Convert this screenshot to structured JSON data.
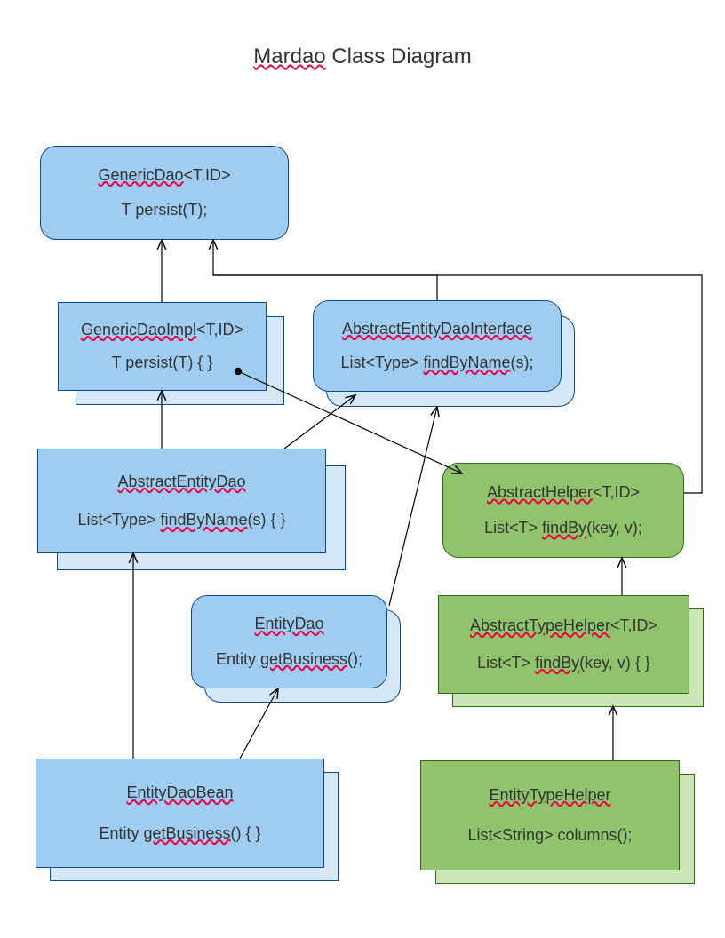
{
  "title": {
    "pre": "Mardao",
    "rest": " Class Diagram"
  },
  "genericDao": {
    "name_pre": "GenericDao",
    "name_suf": "<T,ID>",
    "method": "T persist(T);"
  },
  "genericDaoImpl": {
    "name_pre": "GenericDaoImpl",
    "name_suf": "<T,ID>",
    "method": "T persist(T) { }"
  },
  "abstractEntityDaoInterface": {
    "name": "AbstractEntityDaoInterface",
    "m_pre": "List<Type> ",
    "m_sq": "findByName",
    "m_suf": "(s);"
  },
  "abstractEntityDao": {
    "name": "AbstractEntityDao",
    "m_pre": "List<Type> ",
    "m_sq": "findByName",
    "m_suf": "(s) { }"
  },
  "abstractHelper": {
    "name_pre": "AbstractHelper",
    "name_suf": "<T,ID>",
    "m_pre": "List<T> ",
    "m_sq": "findBy",
    "m_suf": "(key, v);"
  },
  "entityDao": {
    "name": "EntityDao",
    "m_pre": "Entity ",
    "m_sq": "getBusiness",
    "m_suf": "();"
  },
  "abstractTypeHelper": {
    "name_pre": "AbstractTypeHelper",
    "name_suf": "<T,ID>",
    "m_pre": "List<T> ",
    "m_sq": "findBy",
    "m_suf": "(key, v) { }"
  },
  "entityDaoBean": {
    "name": "EntityDaoBean",
    "m_pre": "Entity ",
    "m_sq": "getBusiness",
    "m_suf": "() { }"
  },
  "entityTypeHelper": {
    "name": "EntityTypeHelper",
    "method": "List<String> columns();"
  }
}
